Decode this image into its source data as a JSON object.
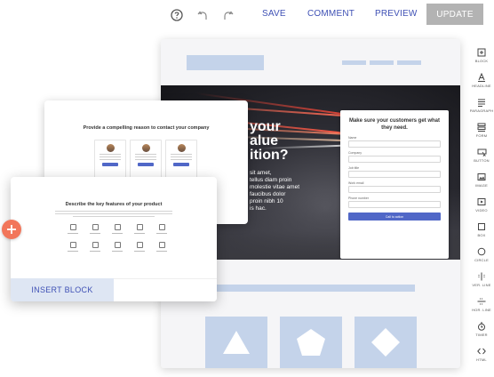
{
  "toolbar": {
    "save_label": "SAVE",
    "comment_label": "COMMENT",
    "preview_label": "PREVIEW",
    "update_label": "UPDATE",
    "accent_color": "#3f51b5",
    "update_bg": "#b3b3b3",
    "icons": [
      "help-icon",
      "undo-icon",
      "redo-icon"
    ]
  },
  "hero": {
    "heading_lines": [
      "your",
      "alue",
      "ition?"
    ],
    "body_lines": [
      "sit amet,",
      "tellus diam proin",
      "molestie vitae amet",
      "faucibus dolor",
      "proin nibh 10",
      "is hac."
    ]
  },
  "contact_form": {
    "title": "Make sure your customers get what they need.",
    "fields": [
      {
        "label": "Name"
      },
      {
        "label": "Company"
      },
      {
        "label": "Job title"
      },
      {
        "label": "Work email"
      },
      {
        "label": "Phone number"
      }
    ],
    "submit_label": "Call to action",
    "submit_color": "#5067c7"
  },
  "palette": {
    "items": [
      {
        "label": "BLOCK",
        "icon": "block-icon"
      },
      {
        "label": "HEADLINE",
        "icon": "headline-icon"
      },
      {
        "label": "PARAGRAPH",
        "icon": "paragraph-icon"
      },
      {
        "label": "FORM",
        "icon": "form-icon"
      },
      {
        "label": "BUTTON",
        "icon": "button-icon"
      },
      {
        "label": "IMAGE",
        "icon": "image-icon"
      },
      {
        "label": "VIDEO",
        "icon": "video-icon"
      },
      {
        "label": "BOX",
        "icon": "box-icon"
      },
      {
        "label": "CIRCLE",
        "icon": "circle-icon"
      },
      {
        "label": "VER. LINE",
        "icon": "vertical-line-icon"
      },
      {
        "label": "HOR. LINE",
        "icon": "horizontal-line-icon"
      },
      {
        "label": "TIMER",
        "icon": "timer-icon"
      },
      {
        "label": "HTML",
        "icon": "html-icon"
      }
    ]
  },
  "template_contact": {
    "title": "Provide a compelling reason to contact your company"
  },
  "template_features": {
    "title": "Describe the key features of your product"
  },
  "insert_block_label": "INSERT BLOCK",
  "colors": {
    "placeholder_blue": "#c4d3ea",
    "plus_button": "#f2765b",
    "insert_bg": "#dee6f3"
  }
}
